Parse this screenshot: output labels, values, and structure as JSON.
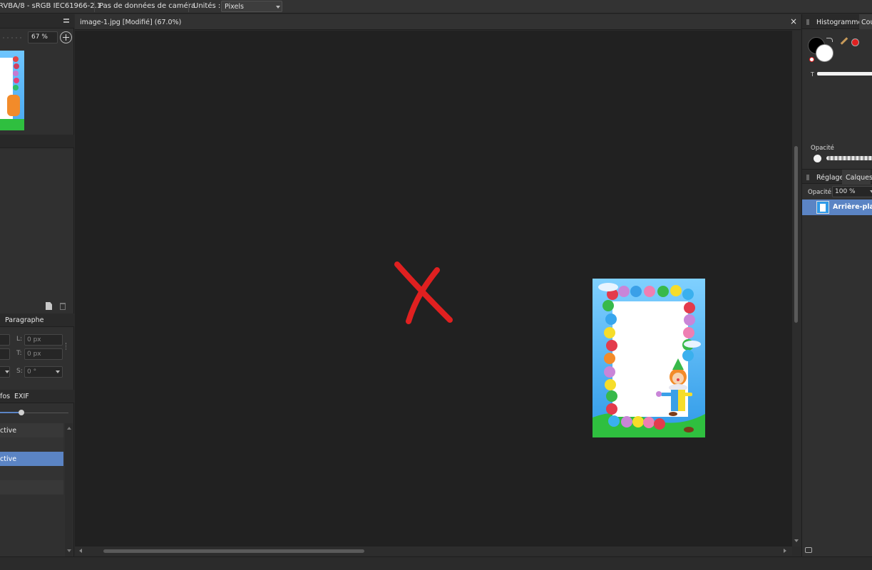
{
  "topbar": {
    "color_format": "RVBA/8 - sRGB IEC61966-2.1",
    "camera": "Pas de données de caméra",
    "units_label": "Unités :",
    "units_value": "Pixels"
  },
  "navigator": {
    "zoom": "67 %"
  },
  "transform": {
    "tab_label": "Paragraphe",
    "l_label": "L:",
    "l_value": "0 px",
    "t_label": "T:",
    "t_value": "0 px",
    "s_label": "S:",
    "s_value": "0 °"
  },
  "info": {
    "tab_fos": "fos",
    "tab_exif": "EXIF",
    "row1": "ctive",
    "row2": "ctive"
  },
  "document": {
    "tab_title": "image-1.jpg [Modifié] (67.0%)",
    "close_glyph": "×"
  },
  "color_panel": {
    "tab_histogram": "Histogramme",
    "tab_color": "Cou",
    "t_label": "T",
    "opacity_label": "Opacité",
    "fg_color": "#000000",
    "bg_color": "#ffffff",
    "picked_color": "#e02020"
  },
  "layers_panel": {
    "tab_adjust": "Réglage",
    "tab_layers": "Calques",
    "opacity_label": "Opacité:",
    "opacity_value": "100 %",
    "layer_name": "Arrière-plan",
    "selection_color": "#5b84c4"
  },
  "annotation": {
    "mark_color": "#e02020"
  }
}
